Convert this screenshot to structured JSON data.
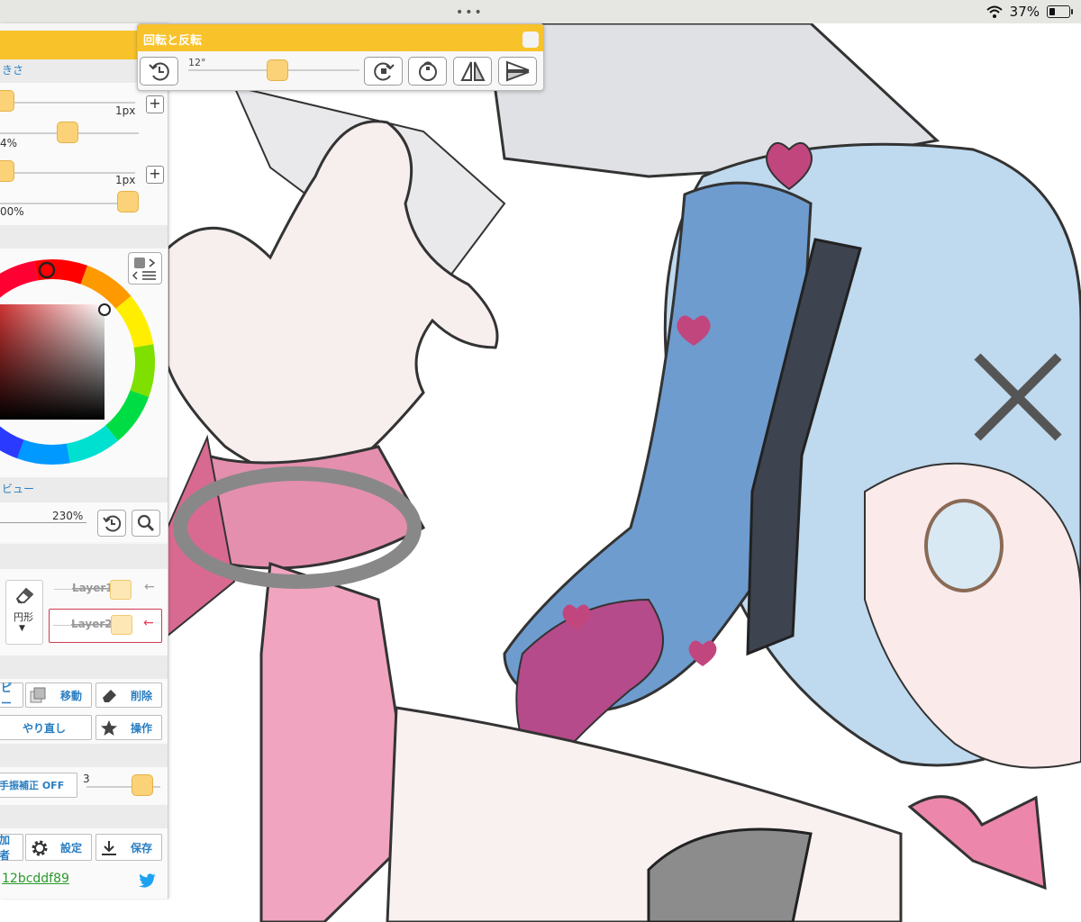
{
  "status_bar": {
    "battery_percent": "37%"
  },
  "rotate_dialog": {
    "title": "回転と反転",
    "angle_label": "12°",
    "buttons": [
      {
        "name": "reset-rotation",
        "icon": "rotate-reset-icon"
      },
      {
        "name": "rotate-right",
        "icon": "rotate-cw-icon"
      },
      {
        "name": "rotate-center",
        "icon": "rotate-center-icon"
      },
      {
        "name": "flip-horizontal",
        "icon": "flip-horizontal-icon"
      },
      {
        "name": "flip-vertical",
        "icon": "flip-vertical-icon"
      }
    ]
  },
  "brush_panel": {
    "size_header": "きさ",
    "size_value": "1px",
    "opacity_value": "4%",
    "size2_value": "1px",
    "opacity2_value": "00%"
  },
  "preview": {
    "header": "ビュー",
    "zoom": "230%"
  },
  "layers": {
    "tool_label": "円形",
    "tool_arrow": "▼",
    "items": [
      {
        "name": "Layer1"
      },
      {
        "name": "Layer2"
      }
    ]
  },
  "actions": {
    "copy": "ピー",
    "move": "移動",
    "delete": "削除",
    "redo": "やり直し",
    "operation": "操作"
  },
  "stabilizer": {
    "label": "手振補正 OFF",
    "value": "3"
  },
  "footer": {
    "participants": "加者",
    "settings": "設定",
    "save": "保存",
    "room_id": "12bcddf89"
  },
  "colors": {
    "accent_yellow": "#f8c22a",
    "knob": "#fbd277",
    "label_blue": "#2b7ec1"
  }
}
